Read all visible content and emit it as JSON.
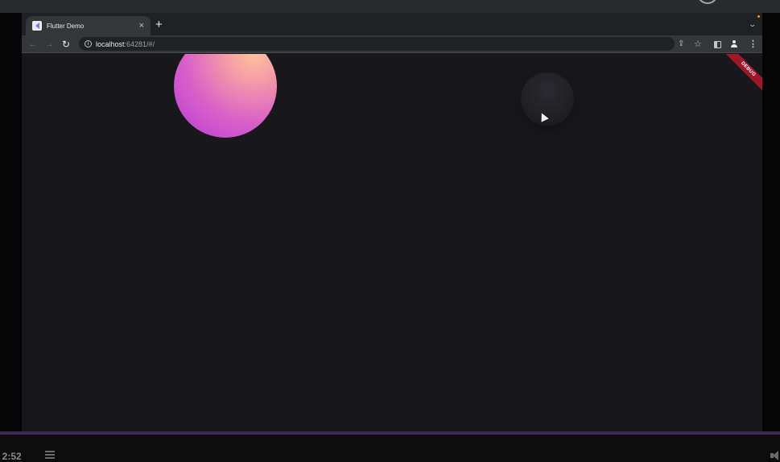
{
  "browser": {
    "tab": {
      "title": "Flutter Demo",
      "close_glyph": "×",
      "favicon": "flutter-icon"
    },
    "new_tab_glyph": "+",
    "tab_search_glyph": "⌄",
    "nav": {
      "back_glyph": "←",
      "forward_glyph": "→",
      "reload_glyph": "↻"
    },
    "address": {
      "host": "localhost",
      "rest": ":64281/#/"
    },
    "toolbar": {
      "share_glyph": "⇪",
      "star_glyph": "☆",
      "menu_glyph": "⋮"
    }
  },
  "app": {
    "debug_banner": "DEBUG",
    "orb_colors": [
      "#ffc49a",
      "#f49aa8",
      "#d860c8",
      "#b63ad8"
    ]
  },
  "player": {
    "time": "/ 2:52"
  }
}
